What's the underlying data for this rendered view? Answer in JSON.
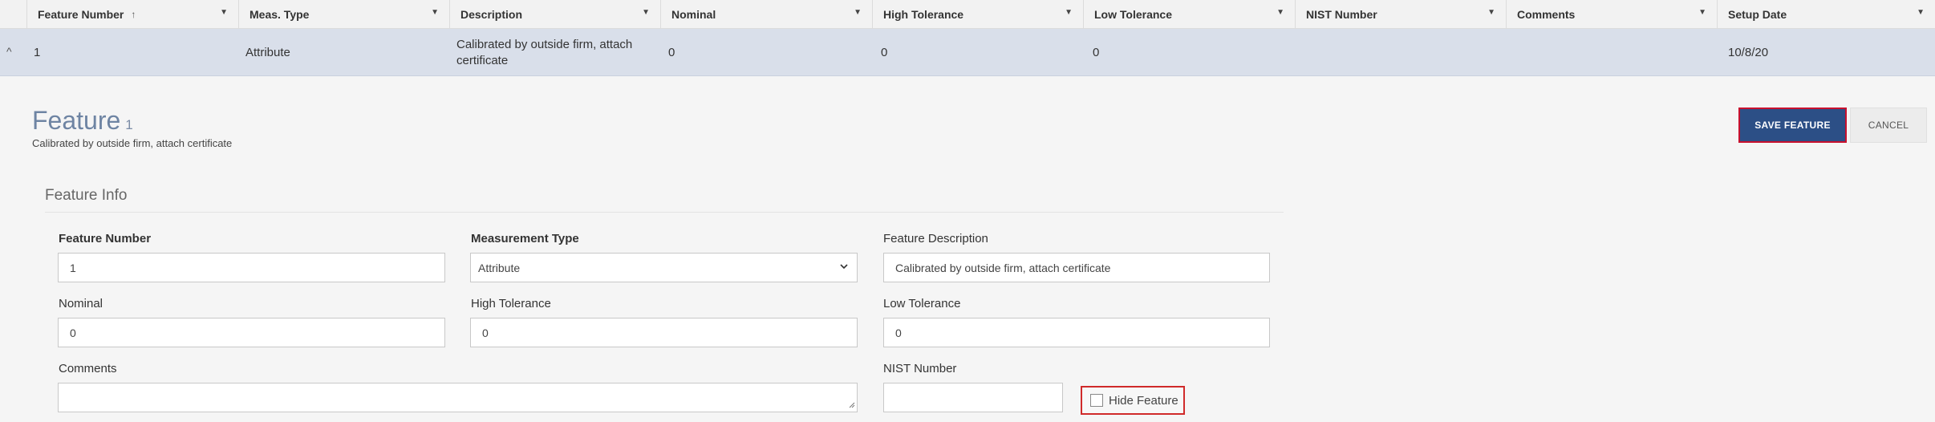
{
  "grid": {
    "columns": [
      {
        "label": "Feature Number",
        "sort_icon": "↑"
      },
      {
        "label": "Meas. Type"
      },
      {
        "label": "Description"
      },
      {
        "label": "Nominal"
      },
      {
        "label": "High Tolerance"
      },
      {
        "label": "Low Tolerance"
      },
      {
        "label": "NIST Number"
      },
      {
        "label": "Comments"
      },
      {
        "label": "Setup Date"
      }
    ],
    "filter_icon": "▼",
    "row": {
      "expand_icon": "^",
      "feature_number": "1",
      "meas_type": "Attribute",
      "description_line1": "Calibrated by outside firm, attach",
      "description_line2": "certificate",
      "nominal": "0",
      "high_tolerance": "0",
      "low_tolerance": "0",
      "nist_number": "",
      "comments": "",
      "setup_date": "10/8/20"
    }
  },
  "detail": {
    "title": "Feature",
    "title_number": "1",
    "subtitle": "Calibrated by outside firm, attach certificate",
    "save_label": "SAVE FEATURE",
    "cancel_label": "CANCEL",
    "section_title": "Feature Info"
  },
  "form": {
    "feature_number": {
      "label": "Feature Number",
      "value": "1"
    },
    "measurement_type": {
      "label": "Measurement Type",
      "value": "Attribute"
    },
    "feature_description": {
      "label": "Feature Description",
      "value": "Calibrated by outside firm, attach certificate"
    },
    "nominal": {
      "label": "Nominal",
      "value": "0"
    },
    "high_tolerance": {
      "label": "High Tolerance",
      "value": "0"
    },
    "low_tolerance": {
      "label": "Low Tolerance",
      "value": "0"
    },
    "comments": {
      "label": "Comments",
      "value": ""
    },
    "nist_number": {
      "label": "NIST Number",
      "value": ""
    },
    "hide_feature": {
      "label": "Hide Feature",
      "checked": false
    }
  }
}
